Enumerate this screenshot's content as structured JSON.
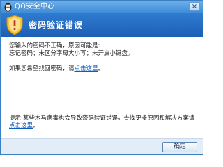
{
  "window": {
    "title": "QQ安全中心",
    "close_label": "×"
  },
  "banner": {
    "title": "密码验证错误",
    "icon": "shield-icon"
  },
  "message": {
    "line1": "您输入的密码不正确，原因可能是:",
    "line2": "忘记密码；未区分字母大小写；未开启小键盘。",
    "retrieve_prefix": "如果您希望找回密码，请",
    "retrieve_link": "点击这里",
    "retrieve_suffix": "。"
  },
  "tip": {
    "line1": "提示:某些木马病毒也会导致密码验证错误，查找更多原因和解决方案请",
    "link": "点击这里",
    "suffix": "。"
  },
  "footer": {
    "ok_label": "确定"
  },
  "colors": {
    "titlebar": "#3c8ad8",
    "banner": "#1c5fb6",
    "link": "#0b5dbf"
  }
}
